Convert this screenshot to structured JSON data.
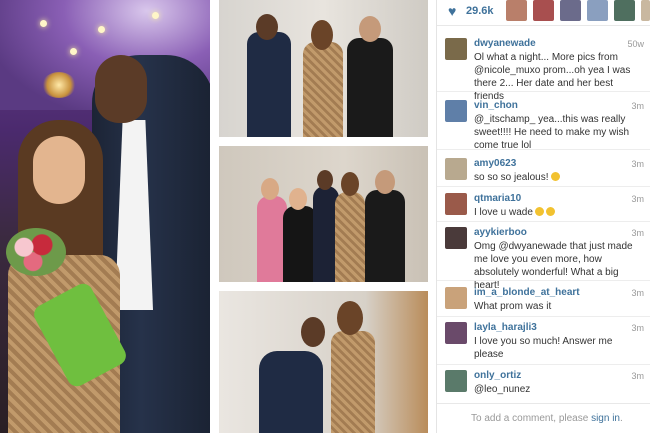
{
  "likes": {
    "count": "29.6k"
  },
  "comments": [
    {
      "user": "dwyanewade",
      "text": "Ol what a night... More pics from @nicole_muxo prom...oh yea I was there 2... Her date and her best friends",
      "time": "50w",
      "avatar_color": "#7a6a4a"
    },
    {
      "user": "vin_chon",
      "text": "@_itschamp_ yea...this was really sweet!!!! He need to make my wish come true lol",
      "time": "3m",
      "avatar_color": "#5f7fa8"
    },
    {
      "user": "amy0623",
      "text": "so so so jealous!",
      "time": "3m",
      "avatar_color": "#b8a98f",
      "emoji": true
    },
    {
      "user": "qtmaria10",
      "text": "I love u wade",
      "time": "3m",
      "avatar_color": "#9a5a4a",
      "emoji": true
    },
    {
      "user": "ayykierboo",
      "text": "Omg @dwyanewade that just made me love you even more, how absolutely wonderful! What a big heart!",
      "time": "3m",
      "avatar_color": "#4a3a3a"
    },
    {
      "user": "im_a_blonde_at_heart",
      "text": "What prom was it",
      "time": "3m",
      "avatar_color": "#c9a27a"
    },
    {
      "user": "layla_harajli3",
      "text": "I love you so much! Answer me please",
      "time": "3m",
      "avatar_color": "#6a4a6a"
    },
    {
      "user": "only_ortiz",
      "text": "@leo_nunez",
      "time": "3m",
      "avatar_color": "#5a7a6a"
    }
  ],
  "add_comment": {
    "prefix": "To add a comment, please ",
    "link": "sign in",
    "suffix": "."
  },
  "colors": {
    "accent": "#3f729b"
  }
}
